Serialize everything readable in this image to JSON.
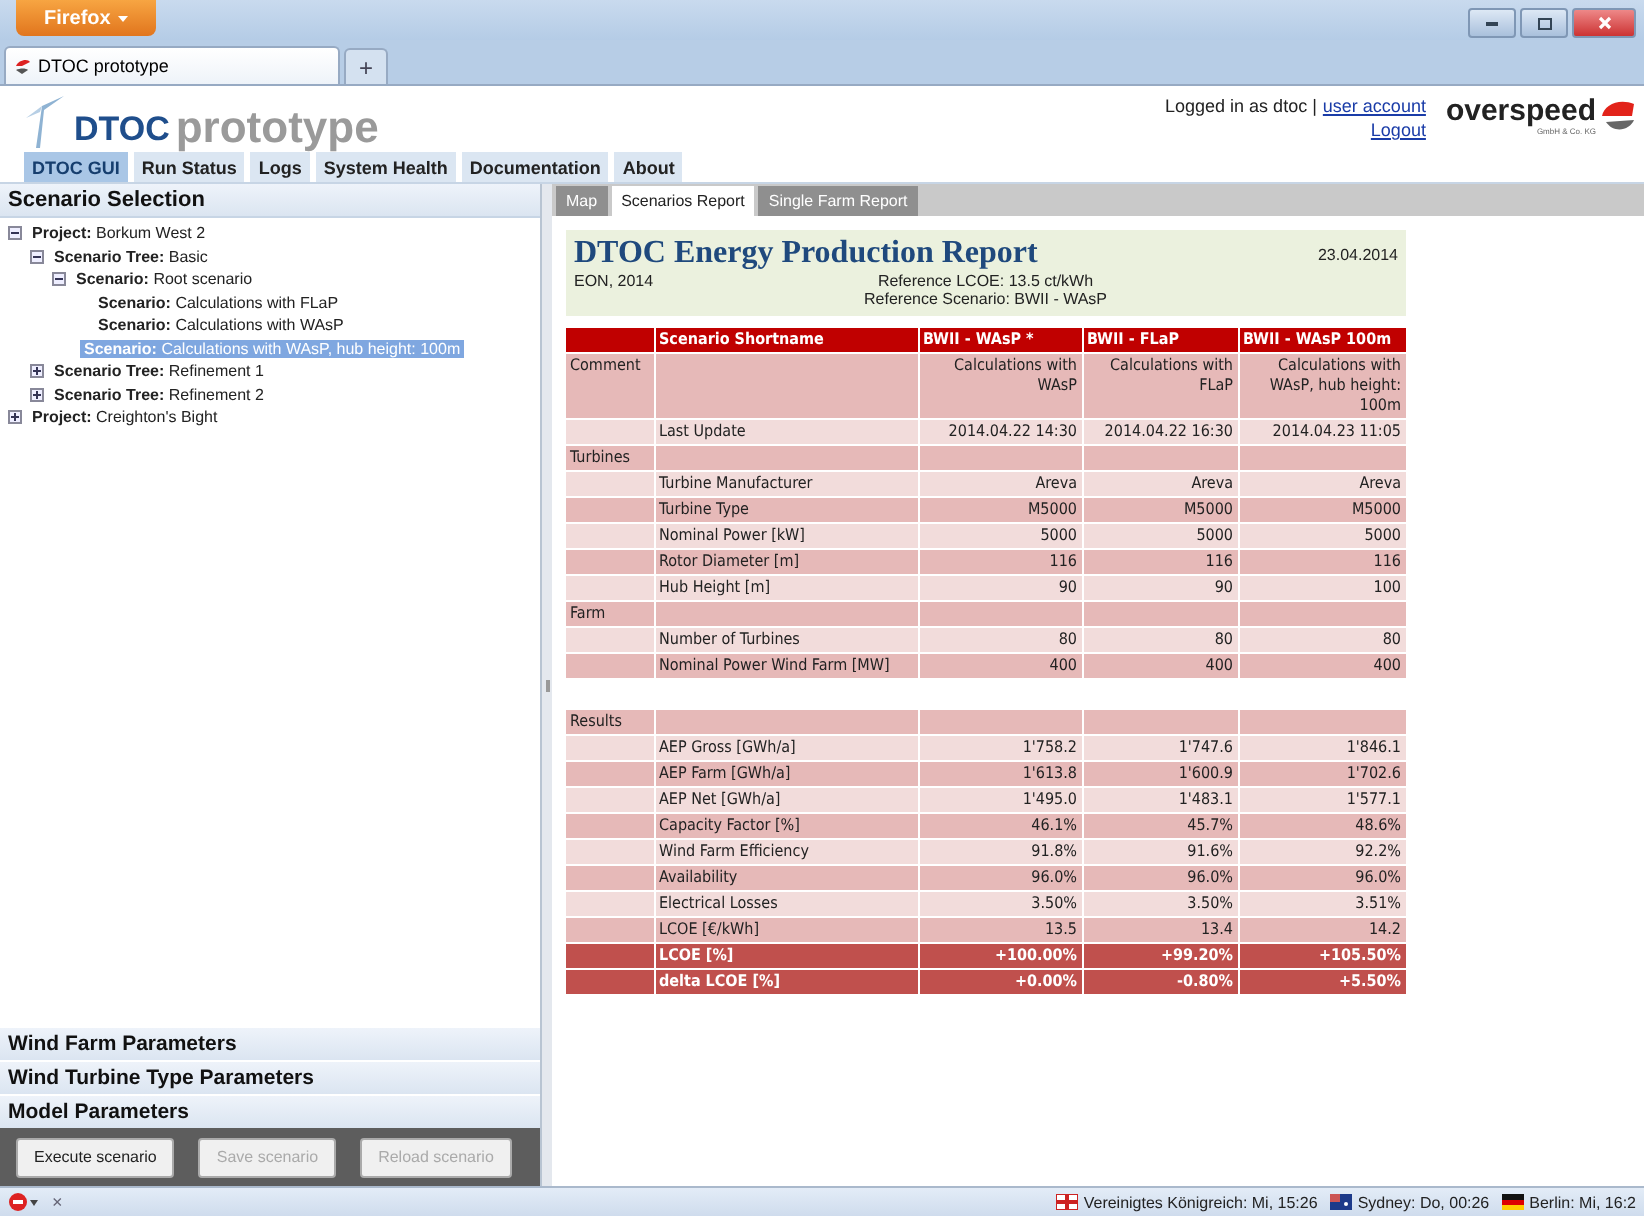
{
  "browser": {
    "menu_button": "Firefox",
    "tabs": [
      {
        "title": "DTOC prototype",
        "selected": true
      }
    ],
    "new_tab": "+"
  },
  "header": {
    "logo_brand": "DTOC",
    "logo_text": "prototype",
    "login_text": "Logged in as dtoc |",
    "account_link": "user account",
    "logout_link": "Logout",
    "company": "overspeed",
    "company_sub": "GmbH & Co. KG"
  },
  "nav": [
    {
      "label": "DTOC GUI",
      "selected": true
    },
    {
      "label": "Run Status",
      "selected": false
    },
    {
      "label": "Logs",
      "selected": false
    },
    {
      "label": "System Health",
      "selected": false
    },
    {
      "label": "Documentation",
      "selected": false
    },
    {
      "label": "About",
      "selected": false
    }
  ],
  "sidebar": {
    "title": "Scenario Selection",
    "tree": [
      {
        "label": "**Project:** Borkum West 2",
        "expanded": true,
        "selected": false,
        "children": [
          {
            "label": "**Scenario Tree:** Basic",
            "expanded": true,
            "selected": false,
            "children": [
              {
                "label": "**Scenario:** Root scenario",
                "expanded": true,
                "selected": false,
                "children": [
                  {
                    "label": "**Scenario:** Calculations with FLaP",
                    "selected": false
                  },
                  {
                    "label": "**Scenario:** Calculations with WAsP",
                    "selected": false
                  },
                  {
                    "label": "**Scenario:** Calculations with WAsP, hub height: 100m",
                    "selected": true
                  }
                ]
              }
            ]
          },
          {
            "label": "**Scenario Tree:** Refinement 1",
            "expanded": false,
            "selected": false
          },
          {
            "label": "**Scenario Tree:** Refinement 2",
            "expanded": false,
            "selected": false
          }
        ]
      },
      {
        "label": "**Project:** Creighton's Bight",
        "expanded": false,
        "selected": false
      }
    ],
    "sections": [
      "Wind Farm Parameters",
      "Wind Turbine Type Parameters",
      "Model Parameters"
    ],
    "buttons": [
      {
        "label": "Execute scenario",
        "disabled": false
      },
      {
        "label": "Save scenario",
        "disabled": true
      },
      {
        "label": "Reload scenario",
        "disabled": true
      }
    ]
  },
  "report_tabs": [
    {
      "label": "Map",
      "selected": false
    },
    {
      "label": "Scenarios Report",
      "selected": true
    },
    {
      "label": "Single Farm Report",
      "selected": false
    }
  ],
  "report": {
    "title": "DTOC Energy Production Report",
    "date": "23.04.2014",
    "author": "EON, 2014",
    "reference_lcoe": "Reference LCOE: 13.5 ct/kWh",
    "reference_scenario": "Reference Scenario: BWII - WAsP",
    "rows": [
      {
        "kind": "header",
        "label": "Scenario Shortname",
        "values": [
          "BWII - WAsP *",
          "BWII - FLaP",
          "BWII - WAsP 100m"
        ]
      },
      {
        "kind": "data",
        "group": "Comment",
        "values": [
          "Calculations with WAsP",
          "Calculations with FLaP",
          "Calculations with WAsP, hub height: 100m"
        ]
      },
      {
        "kind": "data",
        "label": "Last Update",
        "values": [
          "2014.04.22 14:30",
          "2014.04.22 16:30",
          "2014.04.23 11:05"
        ]
      },
      {
        "kind": "group",
        "group": "Turbines"
      },
      {
        "kind": "data",
        "label": "Turbine Manufacturer",
        "values": [
          "Areva",
          "Areva",
          "Areva"
        ]
      },
      {
        "kind": "data",
        "label": "Turbine Type",
        "values": [
          "M5000",
          "M5000",
          "M5000"
        ]
      },
      {
        "kind": "data",
        "label": "Nominal Power [kW]",
        "values": [
          "5000",
          "5000",
          "5000"
        ]
      },
      {
        "kind": "data",
        "label": "Rotor Diameter [m]",
        "values": [
          "116",
          "116",
          "116"
        ]
      },
      {
        "kind": "data",
        "label": "Hub Height [m]",
        "values": [
          "90",
          "90",
          "100"
        ]
      },
      {
        "kind": "group",
        "group": "Farm"
      },
      {
        "kind": "data",
        "label": "Number of Turbines",
        "values": [
          "80",
          "80",
          "80"
        ]
      },
      {
        "kind": "data",
        "label": "Nominal Power Wind Farm [MW]",
        "values": [
          "400",
          "400",
          "400"
        ]
      },
      {
        "kind": "spacer"
      },
      {
        "kind": "group",
        "group": "Results"
      },
      {
        "kind": "data",
        "label": "AEP Gross [GWh/a]",
        "values": [
          "1'758.2",
          "1'747.6",
          "1'846.1"
        ]
      },
      {
        "kind": "data",
        "label": "AEP Farm [GWh/a]",
        "values": [
          "1'613.8",
          "1'600.9",
          "1'702.6"
        ]
      },
      {
        "kind": "data",
        "label": "AEP Net [GWh/a]",
        "values": [
          "1'495.0",
          "1'483.1",
          "1'577.1"
        ]
      },
      {
        "kind": "data",
        "label": "Capacity Factor [%]",
        "values": [
          "46.1%",
          "45.7%",
          "48.6%"
        ]
      },
      {
        "kind": "data",
        "label": "Wind Farm Efficiency",
        "values": [
          "91.8%",
          "91.6%",
          "92.2%"
        ]
      },
      {
        "kind": "data",
        "label": "Availability",
        "values": [
          "96.0%",
          "96.0%",
          "96.0%"
        ]
      },
      {
        "kind": "data",
        "label": "Electrical Losses",
        "values": [
          "3.50%",
          "3.50%",
          "3.51%"
        ]
      },
      {
        "kind": "data",
        "label": "LCOE [€/kWh]",
        "values": [
          "13.5",
          "13.4",
          "14.2"
        ]
      },
      {
        "kind": "result",
        "label": "LCOE [%]",
        "values": [
          "+100.00%",
          "+99.20%",
          "+105.50%"
        ]
      },
      {
        "kind": "result",
        "label": "delta LCOE [%]",
        "values": [
          "+0.00%",
          "-0.80%",
          "+5.50%"
        ]
      }
    ]
  },
  "status_bar": {
    "close": "×",
    "clocks": [
      {
        "kind": "uk",
        "text": "Vereinigtes Königreich: Mi, 15:26"
      },
      {
        "kind": "australia",
        "text": "Sydney: Do, 00:26"
      },
      {
        "kind": "germany",
        "text": "Berlin: Mi, 16:2"
      }
    ]
  }
}
